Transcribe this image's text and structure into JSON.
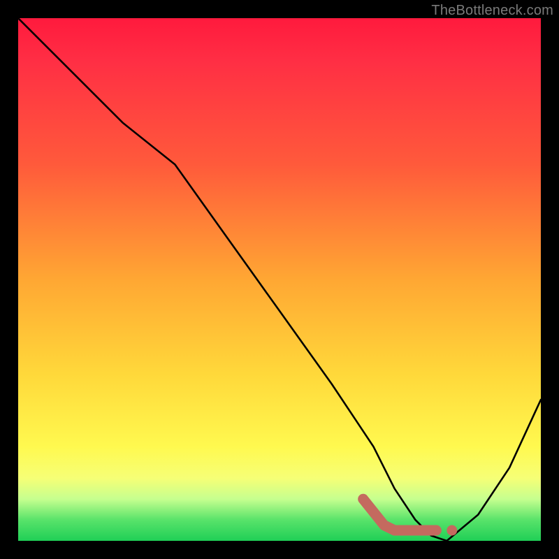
{
  "watermark": "TheBottleneck.com",
  "chart_data": {
    "type": "line",
    "title": "",
    "xlabel": "",
    "ylabel": "",
    "xlim": [
      0,
      100
    ],
    "ylim": [
      0,
      100
    ],
    "series": [
      {
        "name": "bottleneck-curve",
        "x": [
          0,
          8,
          20,
          30,
          40,
          50,
          60,
          68,
          72,
          76,
          79,
          82,
          88,
          94,
          100
        ],
        "y": [
          100,
          92,
          80,
          72,
          58,
          44,
          30,
          18,
          10,
          4,
          1,
          0,
          5,
          14,
          27
        ]
      }
    ],
    "annotations": [
      {
        "name": "highlight-elbow",
        "type": "polyline",
        "x": [
          66,
          70,
          72,
          74,
          76,
          78,
          80
        ],
        "y": [
          8,
          3,
          2,
          2,
          2,
          2,
          2
        ]
      },
      {
        "name": "highlight-dot",
        "type": "point",
        "x": 83,
        "y": 2
      }
    ]
  }
}
